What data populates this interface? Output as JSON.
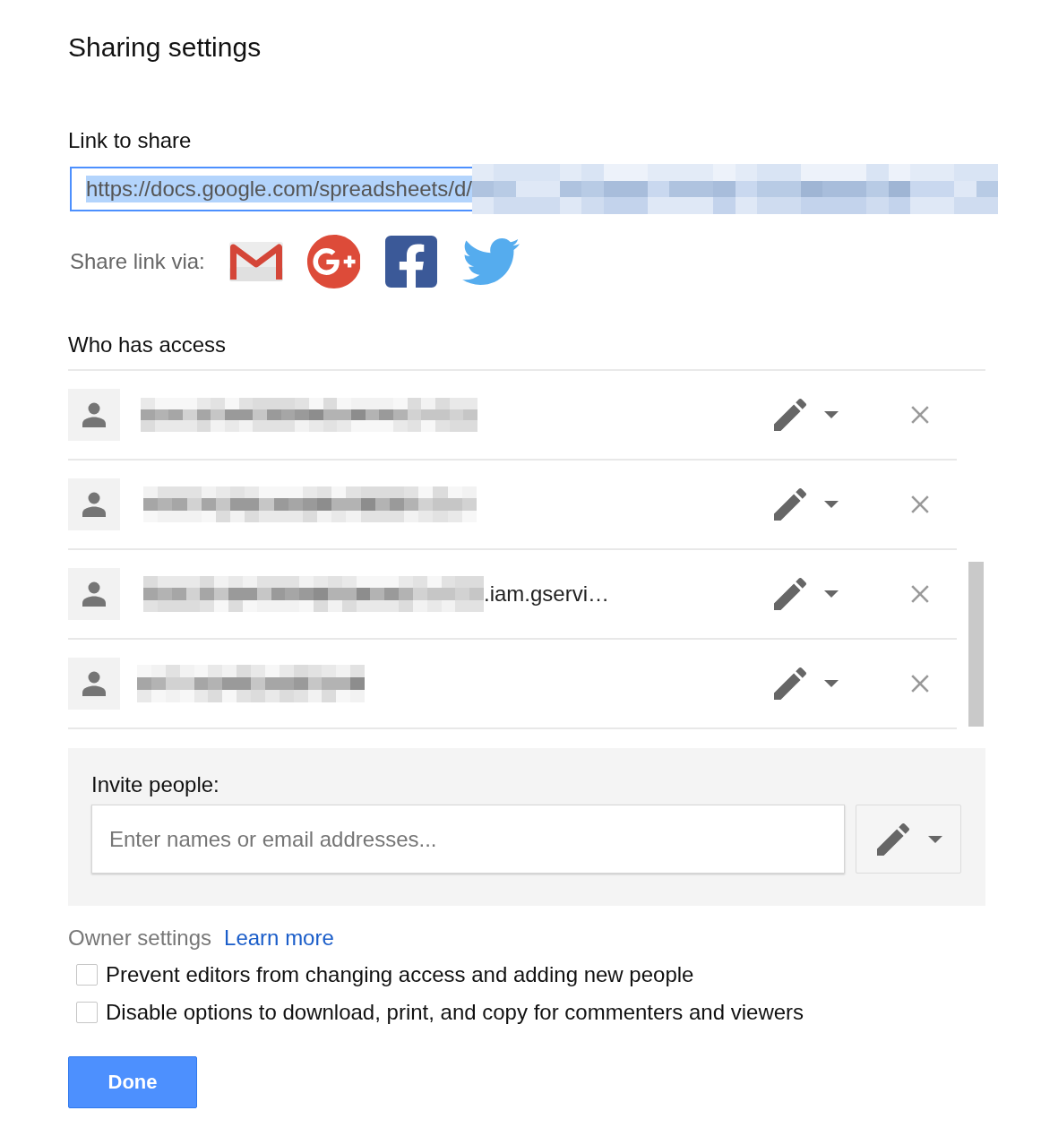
{
  "dialog": {
    "title": "Sharing settings"
  },
  "link_section": {
    "heading": "Link to share",
    "link_field": {
      "value": "https://docs.google.com/spreadsheets/d/",
      "selected": true,
      "redacted": true
    }
  },
  "share_via": {
    "label": "Share link via:"
  },
  "access": {
    "heading": "Who has access",
    "people": [
      {
        "redacted": true
      },
      {
        "redacted": true
      },
      {
        "redacted": true,
        "email_visible": ".iam.gservi…"
      },
      {
        "redacted": true
      }
    ]
  },
  "invite": {
    "label": "Invite people:",
    "field": {
      "placeholder": "Enter names or email addresses..."
    }
  },
  "owner_settings": {
    "label": "Owner settings",
    "link": "Learn more",
    "options": [
      {
        "label": "Prevent editors from changing access and adding new people",
        "checked": false
      },
      {
        "label": "Disable options to download, print, and copy for commenters and viewers",
        "checked": false
      }
    ]
  },
  "buttons": [
    {
      "label": "Done",
      "kind": "primary"
    }
  ]
}
